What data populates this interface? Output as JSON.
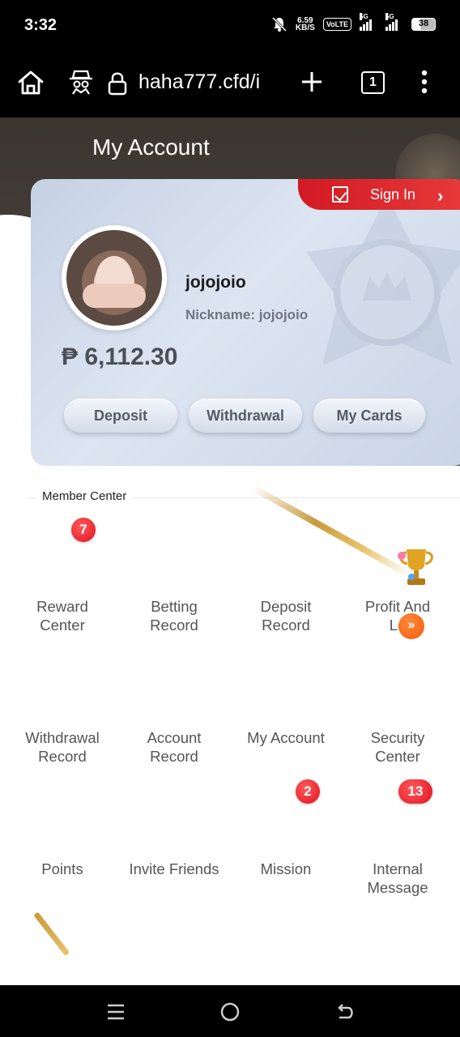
{
  "status_bar": {
    "time": "3:32",
    "net_speed_value": "6.59",
    "net_speed_unit": "KB/S",
    "volte": "VoLTE",
    "sim1_tech": "5G",
    "sim2_tech": "5G",
    "battery": "38",
    "icons": [
      "mute-bell-icon",
      "signal-icon",
      "battery-icon"
    ]
  },
  "browser": {
    "url": "haha777.cfd/i",
    "tab_count": "1",
    "icons": [
      "home-icon",
      "incognito-icon",
      "lock-icon",
      "plus-icon",
      "tabs-icon",
      "menu-dots-icon"
    ]
  },
  "header": {
    "title": "My Account"
  },
  "account_card": {
    "sign_in_label": "Sign In",
    "username": "jojojoio",
    "nickname_label": "Nickname: jojojoio",
    "balance": "₱ 6,112.30",
    "buttons": {
      "deposit": "Deposit",
      "withdrawal": "Withdrawal",
      "my_cards": "My Cards"
    }
  },
  "member_center": {
    "title": "Member Center",
    "items": [
      {
        "label": "Reward\nCenter",
        "badge": "7"
      },
      {
        "label": "Betting\nRecord"
      },
      {
        "label": "Deposit\nRecord"
      },
      {
        "label": "Profit And\nLo"
      },
      {
        "label": "Withdrawal\nRecord"
      },
      {
        "label": "Account\nRecord"
      },
      {
        "label": "My Account",
        "badge": "2"
      },
      {
        "label": "Security\nCenter",
        "badge": "13"
      },
      {
        "label": "Points"
      },
      {
        "label": "Invite Friends"
      },
      {
        "label": "Mission"
      },
      {
        "label": "Internal\nMessage"
      }
    ],
    "scroll_indicator": "»"
  },
  "nav_bar": {
    "icons": [
      "recent-apps-icon",
      "home-circle-icon",
      "back-icon"
    ]
  },
  "colors": {
    "accent_red": "#e0121f",
    "card_bg": "#dde5f1",
    "header_bg": "#3b3530",
    "orange": "#f25a06"
  }
}
